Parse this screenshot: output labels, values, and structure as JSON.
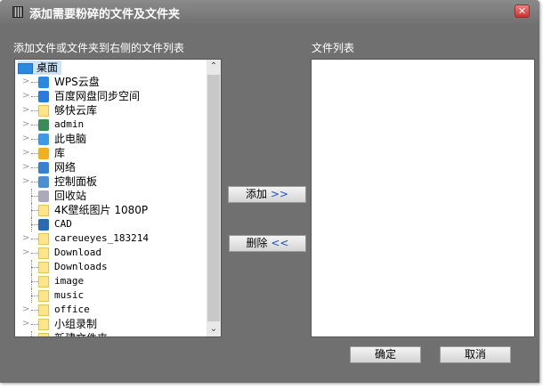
{
  "window": {
    "title": "添加需要粉碎的文件及文件夹",
    "close": "✕"
  },
  "left_label": "添加文件或文件夹到右侧的文件列表",
  "right_label": "文件列表",
  "tree": {
    "root": "桌面",
    "items": [
      {
        "label": "WPS云盘",
        "expand": true,
        "icon": "cloud-icon",
        "mono": false
      },
      {
        "label": "百度网盘同步空间",
        "expand": true,
        "icon": "baidu-netdisk-icon",
        "mono": false
      },
      {
        "label": "够快云库",
        "expand": true,
        "icon": "folder-icon",
        "mono": false
      },
      {
        "label": "admin",
        "expand": true,
        "icon": "user-icon",
        "mono": true
      },
      {
        "label": "此电脑",
        "expand": true,
        "icon": "computer-icon",
        "mono": false
      },
      {
        "label": "库",
        "expand": true,
        "icon": "library-icon",
        "mono": false
      },
      {
        "label": "网络",
        "expand": true,
        "icon": "network-icon",
        "mono": false
      },
      {
        "label": "控制面板",
        "expand": true,
        "icon": "control-panel-icon",
        "mono": false
      },
      {
        "label": "回收站",
        "expand": false,
        "icon": "recycle-bin-icon",
        "mono": false
      },
      {
        "label": "4K壁纸图片 1080P",
        "expand": false,
        "icon": "folder-icon",
        "mono": false
      },
      {
        "label": "CAD",
        "expand": false,
        "icon": "shield-icon",
        "mono": true
      },
      {
        "label": "careueyes_183214",
        "expand": true,
        "icon": "folder-icon",
        "mono": true
      },
      {
        "label": "Download",
        "expand": true,
        "icon": "folder-icon",
        "mono": true
      },
      {
        "label": "Downloads",
        "expand": false,
        "icon": "folder-icon",
        "mono": true
      },
      {
        "label": "image",
        "expand": false,
        "icon": "folder-icon",
        "mono": true
      },
      {
        "label": "music",
        "expand": false,
        "icon": "folder-icon",
        "mono": true
      },
      {
        "label": "office",
        "expand": true,
        "icon": "folder-icon",
        "mono": true
      },
      {
        "label": "小组录制",
        "expand": true,
        "icon": "folder-icon",
        "mono": false
      },
      {
        "label": "新建文件夹",
        "expand": false,
        "icon": "folder-icon",
        "mono": false
      }
    ]
  },
  "buttons": {
    "add": "添加",
    "add_arrow": ">>",
    "remove": "删除",
    "remove_arrow": "<<",
    "ok": "确定",
    "cancel": "取消"
  }
}
